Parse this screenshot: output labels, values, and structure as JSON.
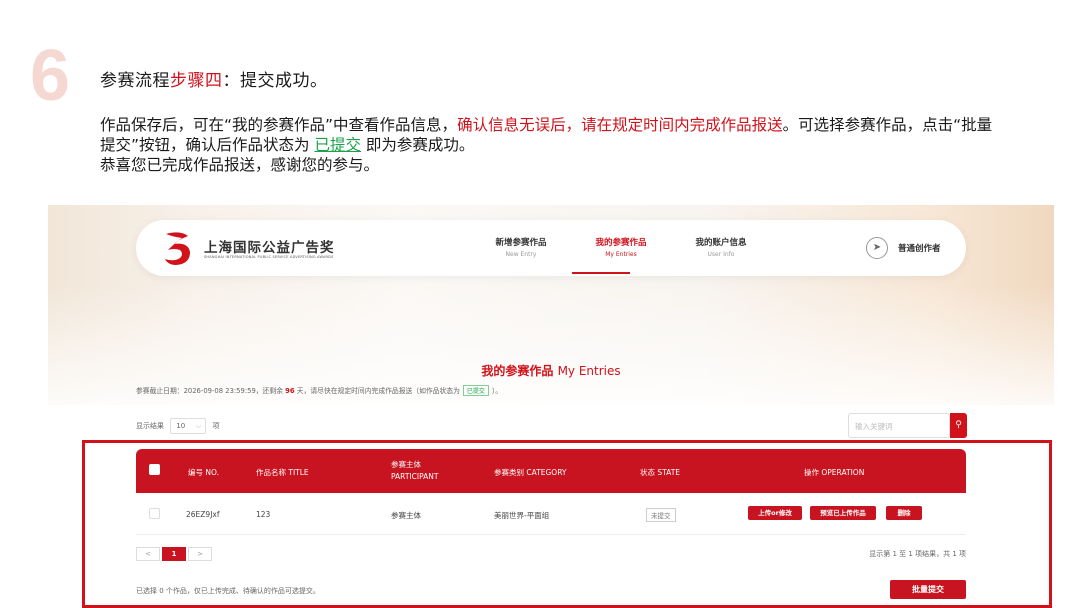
{
  "step": {
    "number": "6",
    "title_prefix": "参赛流程",
    "title_highlight": "步骤四",
    "title_suffix": "：提交成功。",
    "desc_part1": "作品保存后，可在“我的参赛作品”中查看作品信息，",
    "desc_red": "确认信息无误后，请在规定时间内完成作品报送",
    "desc_part2": "。可选择参赛作品，点击“批量提交”按钮，确认后作品状态为 ",
    "desc_green": "已提交",
    "desc_part3": " 即为参赛成功。",
    "desc_line3": "恭喜您已完成作品报送，感谢您的参与。"
  },
  "nav": {
    "logo_cn": "上海国际公益广告奖",
    "logo_en": "SHANGHAI INTERNATIONAL PUBLIC SERVICE ADVERTISING AWARDS",
    "items": [
      {
        "cn": "新增参赛作品",
        "en": "New Entry"
      },
      {
        "cn": "我的参赛作品",
        "en": "My Entries"
      },
      {
        "cn": "我的账户信息",
        "en": "User Info"
      }
    ],
    "user_name": "普通创作者",
    "accent": "#d0121b"
  },
  "main": {
    "heading_cn": "我的参赛作品",
    "heading_en": "My Entries",
    "deadline_pre": "参赛截止日期：2026-09-08 23:59:59，还剩余 ",
    "deadline_days": "96",
    "deadline_mid": " 天，请尽快在规定时间内完成作品报送（如作品状态为",
    "deadline_tag": "已提交",
    "deadline_post": "）。",
    "show_label": "显示结果",
    "show_value": "10",
    "show_unit": "项",
    "search_placeholder": "输入关键词"
  },
  "table": {
    "headers": {
      "no": "编号 NO.",
      "title": "作品名称 TITLE",
      "participant_cn": "参赛主体",
      "participant_en": "PARTICIPANT",
      "category": "参赛类别 CATEGORY",
      "state": "状态 STATE",
      "operation": "操作 OPERATION"
    },
    "rows": [
      {
        "no": "26EZ9Jxf",
        "title": "123",
        "participant": "参赛主体",
        "category": "美丽世界-平面组",
        "state": "未提交",
        "ops": [
          "上传or修改",
          "预览已上传作品",
          "删除"
        ]
      }
    ]
  },
  "pagination": {
    "prev": "<",
    "current": "1",
    "next": ">",
    "info": "显示第 1 至 1 项结果，共 1 项"
  },
  "footer": {
    "note": "已选择 0 个作品，仅已上传完成、待确认的作品可选提交。",
    "batch_button": "批量提交"
  }
}
